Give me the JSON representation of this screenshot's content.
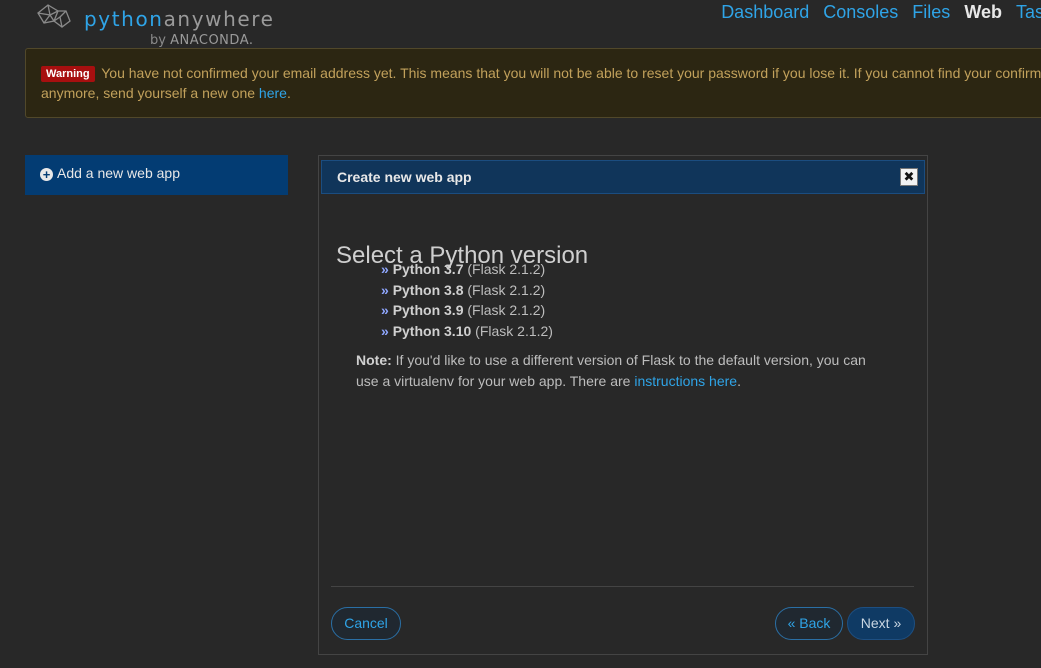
{
  "logo": {
    "brand_prefix": "python",
    "brand_suffix": "anywhere",
    "by_text": "by",
    "company": "ANACONDA."
  },
  "nav": {
    "items": [
      {
        "label": "Dashboard"
      },
      {
        "label": "Consoles"
      },
      {
        "label": "Files"
      },
      {
        "label": "Web"
      },
      {
        "label": "Tas"
      }
    ]
  },
  "warning": {
    "badge": "Warning",
    "message": "You have not confirmed your email address yet. This means that you will not be able to reset your password if you lose it. If you cannot find your confirma",
    "message_line2": "anymore, send yourself a new one ",
    "link": "here",
    "end": "."
  },
  "sidebar": {
    "add_label": "Add a new web app",
    "add_icon": "plus-circle-icon"
  },
  "wizard": {
    "title": "Create new web app",
    "close_icon": "close-icon",
    "step_title": "Select a Python version",
    "options": [
      {
        "arrow": "»",
        "version": "Python 3.7",
        "detail": "(Flask 2.1.2)"
      },
      {
        "arrow": "»",
        "version": "Python 3.8",
        "detail": "(Flask 2.1.2)"
      },
      {
        "arrow": "»",
        "version": "Python 3.9",
        "detail": "(Flask 2.1.2)"
      },
      {
        "arrow": "»",
        "version": "Python 3.10",
        "detail": "(Flask 2.1.2)"
      }
    ],
    "note_label": "Note:",
    "note_text": " If you'd like to use a different version of Flask to the default version, you can use a virtualenv for your web app. There are ",
    "note_link": "instructions here",
    "note_end": ".",
    "cancel": "Cancel",
    "back": "« Back",
    "next": "Next »"
  }
}
